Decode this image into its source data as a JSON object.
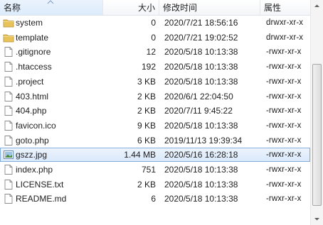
{
  "header": {
    "name_label": "名称",
    "size_label": "大小",
    "time_label": "修改时间",
    "perm_label": "属性"
  },
  "files": [
    {
      "name": "system",
      "size": "0",
      "time": "2020/7/21 18:56:16",
      "perm": "drwxr-xr-x",
      "icon": "folder-icon"
    },
    {
      "name": "template",
      "size": "0",
      "time": "2020/7/21 19:02:52",
      "perm": "drwxr-xr-x",
      "icon": "folder-icon"
    },
    {
      "name": ".gitignore",
      "size": "12",
      "time": "2020/5/18 10:13:38",
      "perm": "-rwxr-xr-x",
      "icon": "file-icon"
    },
    {
      "name": ".htaccess",
      "size": "192",
      "time": "2020/5/18 10:13:38",
      "perm": "-rwxr-xr-x",
      "icon": "file-icon"
    },
    {
      "name": ".project",
      "size": "3 KB",
      "time": "2020/5/18 10:13:38",
      "perm": "-rwxr-xr-x",
      "icon": "file-icon"
    },
    {
      "name": "403.html",
      "size": "2 KB",
      "time": "2020/6/1 22:04:50",
      "perm": "-rwxr-xr-x",
      "icon": "file-icon"
    },
    {
      "name": "404.php",
      "size": "2 KB",
      "time": "2020/7/11 9:45:22",
      "perm": "-rwxr-xr-x",
      "icon": "file-icon"
    },
    {
      "name": "favicon.ico",
      "size": "9 KB",
      "time": "2020/5/18 10:13:38",
      "perm": "-rwxr-xr-x",
      "icon": "file-icon"
    },
    {
      "name": "goto.php",
      "size": "6 KB",
      "time": "2019/11/13 19:39:34",
      "perm": "-rwxr-xr-x",
      "icon": "file-icon"
    },
    {
      "name": "gszz.jpg",
      "size": "1.44 MB",
      "time": "2020/5/16 16:28:18",
      "perm": "-rwxr-xr-x",
      "icon": "image-file-icon",
      "selected": true
    },
    {
      "name": "index.php",
      "size": "751",
      "time": "2020/5/18 10:13:38",
      "perm": "-rwxr-xr-x",
      "icon": "file-icon"
    },
    {
      "name": "LICENSE.txt",
      "size": "2 KB",
      "time": "2020/5/18 10:13:38",
      "perm": "-rwxr-xr-x",
      "icon": "file-icon"
    },
    {
      "name": "README.md",
      "size": "6",
      "time": "2020/5/18 10:13:38",
      "perm": "-rwxr-xr-x",
      "icon": "file-icon"
    }
  ],
  "colors": {
    "selection": "#d9e8fb",
    "selection_border": "#84acdd",
    "folder": "#e8c35a"
  }
}
